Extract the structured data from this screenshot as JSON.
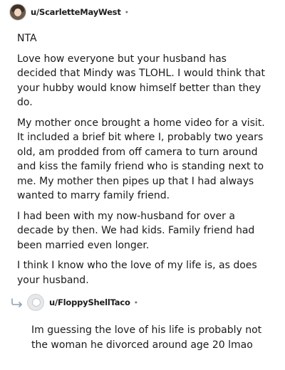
{
  "comment": {
    "username": "u/ScarletteMayWest",
    "separator": "•",
    "paragraphs": [
      "NTA",
      "Love how everyone but your husband has decided that Mindy was TLOHL. I would think that your hubby would know himself better than they do.",
      "My mother once brought a home video for a visit. It included a brief bit where I, probably two years old, am prodded from off camera to turn around and kiss the family friend who is standing next to me. My mother then pipes up that I had always wanted to marry family friend.",
      "I had been with my now-husband for over a decade by then. We had kids. Family friend had been married even longer.",
      "I think I know who the love of my life is, as does your husband."
    ]
  },
  "reply": {
    "username": "u/FloppyShellTaco",
    "separator": "•",
    "text": "Im guessing the love of his life is probably not the woman he divorced around age 20 lmao"
  },
  "icons": {
    "avatar": "user-avatar",
    "reply_arrow": "reply-arrow-icon"
  }
}
